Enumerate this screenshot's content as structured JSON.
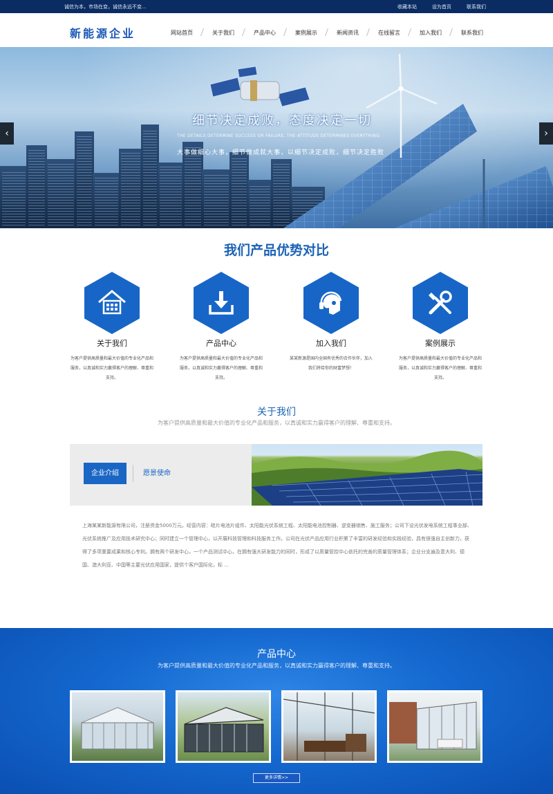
{
  "topbar": {
    "slogan": "诚信为本，市场在变，诚信永远不变...",
    "links": [
      "收藏本站",
      "设为首页",
      "联系我们"
    ]
  },
  "header": {
    "logo": "新能源企业",
    "nav": [
      "网站首页",
      "关于我们",
      "产品中心",
      "案例展示",
      "新闻资讯",
      "在线留言",
      "加入我们",
      "联系我们"
    ]
  },
  "banner": {
    "title": "细节决定成败，态度决定一切",
    "subtitle_en": "THE DETAILS DETERMINE SUCCESS OR FAILURE, THE ATTITUDE DETERMINES EVERYTHING",
    "subtitle_cn": "大事做细心大事，细节做成就大事，以细节决定成败，细节决定胜败",
    "prev_icon": "chevron-left-icon",
    "next_icon": "chevron-right-icon"
  },
  "compare": {
    "title": "我们产品优势对比",
    "features": [
      {
        "icon": "house-icon",
        "title": "关于我们",
        "desc": "为客户提供高质量和最大价值的专业化产品和服务，以真诚和实力赢得客户的理解、尊重和支持。"
      },
      {
        "icon": "download-icon",
        "title": "产品中心",
        "desc": "为客户提供高质量和最大价值的专业化产品和服务，以真诚和实力赢得客户的理解、尊重和支持。"
      },
      {
        "icon": "headset-icon",
        "title": "加入我们",
        "desc": "某某新源是国内全国有优秀的合作伙伴，加入我们将给你的财富梦想！"
      },
      {
        "icon": "tools-icon",
        "title": "案例展示",
        "desc": "为客户提供高质量和最大价值的专业化产品和服务，以真诚和实力赢得客户的理解、尊重和支持。"
      }
    ]
  },
  "about": {
    "title": "关于我们",
    "subtitle": "为客户提供高质量和最大价值的专业化产品和服务，以真诚和实力赢得客户的理解、尊重和支持。",
    "tab_active": "企业介绍",
    "tab_other": "愿景使命",
    "text": "上海某某新能源有限公司，注册资金5000万元。经营内容：硅片电池片组件、太阳能光伏系统工程、太阳能电池控制器、逆变器销售、施工服务；公司下设光伏发电系统工程事业部、光伏系统推广及应用技术研究中心；同时建立一个管理中心，以开展科技管理和科技服务工作。公司在光伏产品应用行业积累了丰富的研发经验和实践经验，具有很强自主创新力，获得了多项重要成果和核心专利。拥有两个研发中心，一个产品测试中心，在拥有强大研发能力的同时，形成了以质量管控中心依托的完善的质量管理体系；企业分支遍及意大利、德国、澳大利亚、中国等主要光伏应用国家，提供个客户国际化，标 ..."
  },
  "products": {
    "title": "产品中心",
    "subtitle": "为客户提供高质量和最大价值的专业化产品和服务，以真诚和实力赢得客户的理解、尊重和支持。",
    "more_label": "更多详情>>"
  },
  "colors": {
    "brand": "#1766c7",
    "topbar": "#0a2c63",
    "accent_title": "#1b62b5"
  }
}
